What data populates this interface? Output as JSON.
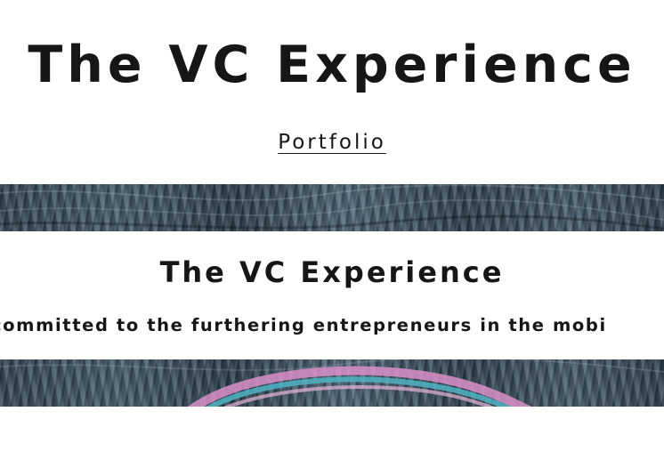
{
  "site": {
    "title": "The VC Experience"
  },
  "nav": {
    "portfolio_label": "Portfolio"
  },
  "section": {
    "title": "The VC Experience",
    "body": "committed to the furthering entrepreneurs in the mobi"
  },
  "colors": {
    "text": "#161616",
    "background": "#ffffff",
    "band_base": "#3a4a56",
    "accent_pink": "#d98fc8",
    "accent_teal": "#4fb3c4"
  },
  "images": {
    "top_band": "abstract-dark-blue-texture",
    "bottom_band": "abstract-texture-with-pink-teal-arc"
  }
}
